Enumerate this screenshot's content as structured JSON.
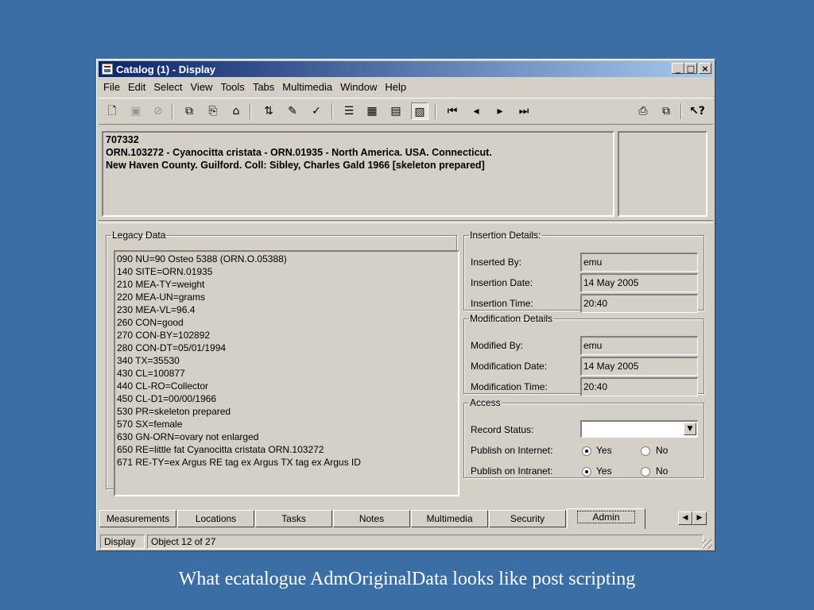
{
  "window": {
    "title": "Catalog (1) - Display",
    "minimize": "_",
    "maximize": "□",
    "close": "×"
  },
  "menu": [
    "File",
    "Edit",
    "Select",
    "View",
    "Tools",
    "Tabs",
    "Multimedia",
    "Window",
    "Help"
  ],
  "toolbar_icons": [
    "new-icon",
    "save-icon",
    "delete-icon",
    "copy-icon",
    "paste-icon",
    "folder-icon",
    "sort-icon",
    "edit-icon",
    "spellcheck-icon",
    "list-view-icon",
    "grid-view-icon",
    "page-view-icon",
    "display-view-icon",
    "first-record-icon",
    "previous-record-icon",
    "next-record-icon",
    "last-record-icon",
    "attach-icon",
    "duplicate-icon",
    "help-icon"
  ],
  "summary": {
    "line1": "707332",
    "line2": "ORN.103272 -  Cyanocitta cristata - ORN.01935 -  North America.  USA.  Connecticut.",
    "line3": "New Haven County.  Guilford. Coll: Sibley, Charles Gald 1966 [skeleton prepared]"
  },
  "legacy": {
    "legend": "Legacy Data",
    "lines": [
      "090 NU=90 Osteo 5388 (ORN.O.05388)",
      "140 SITE=ORN.01935",
      "210 MEA-TY=weight",
      "220 MEA-UN=grams",
      "230 MEA-VL=96.4",
      "260 CON=good",
      "270 CON-BY=102892",
      "280 CON-DT=05/01/1994",
      "340 TX=35530",
      "430 CL=100877",
      "440 CL-RO=Collector",
      "450 CL-D1=00/00/1966",
      "530 PR=skeleton prepared",
      "570 SX=female",
      "630 GN-ORN=ovary not enlarged",
      "650 RE=little fat Cyanocitta cristata ORN.103272",
      "671 RE-TY=ex Argus RE tag ex Argus TX tag ex Argus ID"
    ]
  },
  "insertion": {
    "legend": "Insertion Details:",
    "by_label": "Inserted By:",
    "by_value": "emu",
    "date_label": "Insertion Date:",
    "date_value": "14 May 2005",
    "time_label": "Insertion Time:",
    "time_value": "20:40"
  },
  "modification": {
    "legend": "Modification Details",
    "by_label": "Modified By:",
    "by_value": "emu",
    "date_label": "Modification Date:",
    "date_value": "14 May 2005",
    "time_label": "Modification Time:",
    "time_value": "20:40"
  },
  "access": {
    "legend": "Access",
    "status_label": "Record Status:",
    "status_value": "",
    "internet_label": "Publish on Internet:",
    "intranet_label": "Publish on Intranet:",
    "yes": "Yes",
    "no": "No",
    "internet_selected": "Yes",
    "intranet_selected": "Yes"
  },
  "tabs": [
    "Measurements",
    "Locations",
    "Tasks",
    "Notes",
    "Multimedia",
    "Security",
    "Admin"
  ],
  "active_tab": "Admin",
  "status": {
    "mode": "Display",
    "position": "Object 12 of 27"
  },
  "caption": "What ecatalogue AdmOriginalData looks like post scripting"
}
